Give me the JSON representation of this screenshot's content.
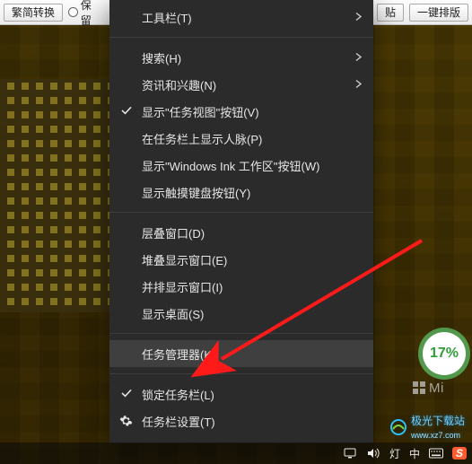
{
  "toolbar": {
    "btn_convert": "繁简转换",
    "radio_keep": "保留",
    "btn_paste_end": "贴",
    "btn_autolayout": "一键排版"
  },
  "menu": {
    "toolbars": "工具栏(T)",
    "search": "搜索(H)",
    "news": "资讯和兴趣(N)",
    "show_taskview": "显示\"任务视图\"按钮(V)",
    "show_people": "在任务栏上显示人脉(P)",
    "show_ink": "显示\"Windows Ink 工作区\"按钮(W)",
    "show_touchkb": "显示触摸键盘按钮(Y)",
    "cascade": "层叠窗口(D)",
    "stack": "堆叠显示窗口(E)",
    "sidebyside": "并排显示窗口(I)",
    "show_desktop": "显示桌面(S)",
    "task_manager": "任务管理器(K)",
    "lock_taskbar": "锁定任务栏(L)",
    "taskbar_settings": "任务栏设置(T)"
  },
  "badge_percent": "17%",
  "watermark_text": "极光下载站",
  "watermark_domain": "www.xz7.com",
  "ms_text": "Mi",
  "tray": {
    "ime1": "灯",
    "ime2": "中",
    "sogou": "S"
  }
}
